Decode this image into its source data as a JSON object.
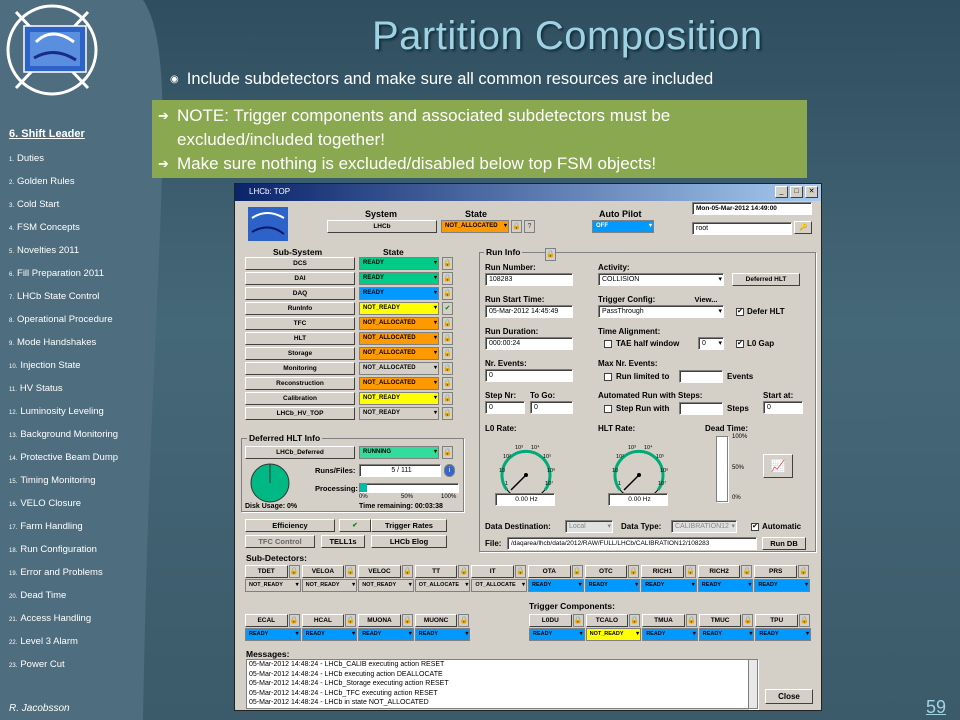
{
  "slide": {
    "title": "Partition Composition",
    "bullet": "Include subdetectors and make sure all common resources are included",
    "notes": [
      "NOTE: Trigger components and associated subdetectors must be",
      "excluded/included together!",
      "Make sure nothing is excluded/disabled below top FSM objects!"
    ],
    "page_number": "59",
    "author": "R. Jacobsson"
  },
  "sidebar": {
    "title": "6. Shift Leader",
    "items": [
      {
        "num": "1.",
        "label": "Duties"
      },
      {
        "num": "2.",
        "label": "Golden Rules"
      },
      {
        "num": "3.",
        "label": "Cold Start"
      },
      {
        "num": "4.",
        "label": "FSM Concepts"
      },
      {
        "num": "5.",
        "label": "Novelties 2011"
      },
      {
        "num": "6.",
        "label": "Fill Preparation 2011"
      },
      {
        "num": "7.",
        "label": "LHCb State Control"
      },
      {
        "num": "8.",
        "label": "Operational Procedure"
      },
      {
        "num": "9.",
        "label": "Mode Handshakes"
      },
      {
        "num": "10.",
        "label": "Injection State"
      },
      {
        "num": "11.",
        "label": "HV Status"
      },
      {
        "num": "12.",
        "label": "Luminosity Leveling"
      },
      {
        "num": "13.",
        "label": "Background Monitoring"
      },
      {
        "num": "14.",
        "label": "Protective Beam Dump"
      },
      {
        "num": "15.",
        "label": "Timing Monitoring"
      },
      {
        "num": "16.",
        "label": "VELO Closure"
      },
      {
        "num": "17.",
        "label": "Farm Handling"
      },
      {
        "num": "18.",
        "label": "Run Configuration"
      },
      {
        "num": "19.",
        "label": "Error and Problems"
      },
      {
        "num": "20.",
        "label": "Dead Time"
      },
      {
        "num": "21.",
        "label": "Access Handling"
      },
      {
        "num": "22.",
        "label": "Level 3 Alarm"
      },
      {
        "num": "23.",
        "label": "Power Cut"
      }
    ]
  },
  "app": {
    "window_title": "LHCb: TOP",
    "system_header": "System",
    "state_header": "State",
    "autopilot_header": "Auto Pilot",
    "system_name": "LHCb",
    "system_state": "NOT_ALLOCATED",
    "autopilot_state": "OFF",
    "datetime": "Mon-05-Mar-2012    14:49:00",
    "user": "root",
    "subsystem_header": "Sub-System",
    "subsystem_state_header": "State",
    "subsystems": [
      {
        "name": "DCS",
        "state": "READY",
        "color": "#00cc88"
      },
      {
        "name": "DAI",
        "state": "READY",
        "color": "#00cc88"
      },
      {
        "name": "DAQ",
        "state": "READY",
        "color": "#0099ff"
      },
      {
        "name": "RunInfo",
        "state": "NOT_READY",
        "color": "#ffff00"
      },
      {
        "name": "TFC",
        "state": "NOT_ALLOCATED",
        "color": "#ff9900"
      },
      {
        "name": "HLT",
        "state": "NOT_ALLOCATED",
        "color": "#ff9900"
      },
      {
        "name": "Storage",
        "state": "NOT_ALLOCATED",
        "color": "#ff9900"
      },
      {
        "name": "Monitoring",
        "state": "NOT_ALLOCATED",
        "color": "#d4d0c8"
      },
      {
        "name": "Reconstruction",
        "state": "NOT_ALLOCATED",
        "color": "#ff9900"
      },
      {
        "name": "Calibration",
        "state": "NOT_READY",
        "color": "#ffff00"
      },
      {
        "name": "LHCb_HV_TOP",
        "state": "NOT_READY",
        "color": "#d4d0c8"
      }
    ],
    "deferred": {
      "title": "Deferred HLT Info",
      "name": "LHCb_Deferred",
      "state": "RUNNING",
      "runs_files_label": "Runs/Files:",
      "runs_files": "5 / 111",
      "processing_label": "Processing:",
      "processing_fraction": 0.07,
      "pct_labels": [
        "0%",
        "50%",
        "100%"
      ],
      "disk_usage": "Disk Usage: 0%",
      "time_remaining": "Time remaining: 00:03:38"
    },
    "buttons": {
      "efficiency": "Efficiency",
      "trigger_rates": "Trigger Rates",
      "tfc_control": "TFC Control",
      "tell1s": "TELL1s",
      "lhcb_elog": "LHCb Elog",
      "run_db": "Run DB",
      "close": "Close",
      "view": "View...",
      "deferred_hlt": "Deferred HLT"
    },
    "runinfo": {
      "title": "Run Info",
      "run_number_label": "Run Number:",
      "run_number": "108283",
      "activity_label": "Activity:",
      "activity": "COLLISION",
      "start_time_label": "Run Start Time:",
      "start_time": "05-Mar-2012 14:45:49",
      "trigger_config_label": "Trigger Config:",
      "trigger_config": "PassThrough",
      "defer_hlt": "Defer HLT",
      "duration_label": "Run Duration:",
      "duration": "000:00:24",
      "time_alignment_label": "Time Alignment:",
      "tae_label": "TAE half window",
      "tae_value": "0",
      "l0_gap": "L0 Gap",
      "nr_events_label": "Nr. Events:",
      "nr_events": "0",
      "max_events_label": "Max Nr. Events:",
      "run_limited_label": "Run limited to",
      "events_label": "Events",
      "step_nr_label": "Step Nr:",
      "step_nr": "0",
      "to_go_label": "To Go:",
      "to_go": "0",
      "auto_run_label": "Automated Run with Steps:",
      "step_run_label": "Step Run with",
      "steps_label": "Steps",
      "start_at_label": "Start at:",
      "start_at": "0",
      "l0_rate_label": "L0 Rate:",
      "hlt_rate_label": "HLT Rate:",
      "dead_time_label": "Dead Time:",
      "l0_rate": "0.00 Hz",
      "hlt_rate": "0.00 Hz",
      "gauge_ticks": [
        "1",
        "10",
        "10²",
        "10³",
        "10⁴",
        "10⁵",
        "10⁶",
        "10⁷"
      ],
      "deadtime_ticks": [
        "100%",
        "50%",
        "0%"
      ],
      "data_destination_label": "Data Destination:",
      "data_destination": "Local",
      "data_type_label": "Data Type:",
      "data_type": "CALIBRATION12",
      "automatic": "Automatic",
      "file_label": "File:",
      "file": "/daqarea/lhcb/data/2012/RAW/FULL/LHCb/CALIBRATION12/108283"
    },
    "subdetectors_title": "Sub-Detectors:",
    "subdetectors_row1": [
      {
        "name": "TDET",
        "state": "NOT_READY",
        "color": "#d4d0c8"
      },
      {
        "name": "VELOA",
        "state": "NOT_READY",
        "color": "#d4d0c8"
      },
      {
        "name": "VELOC",
        "state": "NOT_READY",
        "color": "#d4d0c8"
      },
      {
        "name": "TT",
        "state": "OT_ALLOCATE",
        "color": "#d4d0c8"
      },
      {
        "name": "IT",
        "state": "OT_ALLOCATE",
        "color": "#d4d0c8"
      },
      {
        "name": "OTA",
        "state": "READY",
        "color": "#0099ff"
      },
      {
        "name": "OTC",
        "state": "READY",
        "color": "#0099ff"
      },
      {
        "name": "RICH1",
        "state": "READY",
        "color": "#0099ff"
      },
      {
        "name": "RICH2",
        "state": "READY",
        "color": "#0099ff"
      },
      {
        "name": "PRS",
        "state": "READY",
        "color": "#0099ff"
      }
    ],
    "subdetectors_row2": [
      {
        "name": "ECAL",
        "state": "READY",
        "color": "#0099ff"
      },
      {
        "name": "HCAL",
        "state": "READY",
        "color": "#0099ff"
      },
      {
        "name": "MUONA",
        "state": "READY",
        "color": "#0099ff"
      },
      {
        "name": "MUONC",
        "state": "READY",
        "color": "#0099ff"
      }
    ],
    "trigger_title": "Trigger Components:",
    "trigger_components": [
      {
        "name": "L0DU",
        "state": "READY",
        "color": "#0099ff"
      },
      {
        "name": "TCALO",
        "state": "NOT_READY",
        "color": "#ffff00"
      },
      {
        "name": "TMUA",
        "state": "READY",
        "color": "#0099ff"
      },
      {
        "name": "TMUC",
        "state": "READY",
        "color": "#0099ff"
      },
      {
        "name": "TPU",
        "state": "READY",
        "color": "#0099ff"
      }
    ],
    "messages_title": "Messages:",
    "messages": [
      "05-Mar-2012 14:48:24 - LHCb_CALIB executing action RESET",
      "05-Mar-2012 14:48:24 - LHCb executing action DEALLOCATE",
      "05-Mar-2012 14:48:24 - LHCb_Storage executing action RESET",
      "05-Mar-2012 14:48:24 - LHCb_TFC executing action RESET",
      "05-Mar-2012 14:48:24 - LHCb in state NOT_ALLOCATED"
    ]
  }
}
